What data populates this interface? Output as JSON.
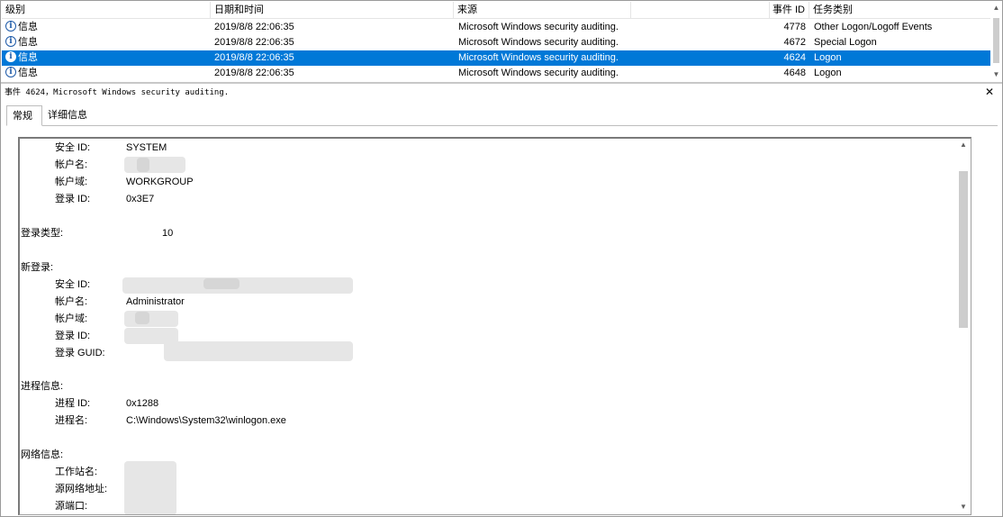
{
  "list": {
    "headers": {
      "level": "级别",
      "date": "日期和时间",
      "source": "来源",
      "event_id": "事件 ID",
      "task": "任务类别"
    },
    "rows": [
      {
        "level": "信息",
        "date": "2019/8/8 22:06:35",
        "source": "Microsoft Windows security auditing.",
        "event_id": "4778",
        "task": "Other Logon/Logoff Events"
      },
      {
        "level": "信息",
        "date": "2019/8/8 22:06:35",
        "source": "Microsoft Windows security auditing.",
        "event_id": "4672",
        "task": "Special Logon"
      },
      {
        "level": "信息",
        "date": "2019/8/8 22:06:35",
        "source": "Microsoft Windows security auditing.",
        "event_id": "4624",
        "task": "Logon"
      },
      {
        "level": "信息",
        "date": "2019/8/8 22:06:35",
        "source": "Microsoft Windows security auditing.",
        "event_id": "4648",
        "task": "Logon"
      }
    ],
    "selected_index": 2
  },
  "detail": {
    "title": "事件 4624，Microsoft Windows security auditing.",
    "close_glyph": "✕",
    "tabs": {
      "general": "常规",
      "details": "详细信息"
    }
  },
  "content": {
    "subject": {
      "security_id_label": "安全 ID:",
      "security_id": "SYSTEM",
      "account_name_label": "帐户名:",
      "account_domain_label": "帐户域:",
      "account_domain": "WORKGROUP",
      "logon_id_label": "登录 ID:",
      "logon_id": "0x3E7"
    },
    "logon_type_label": "登录类型:",
    "logon_type": "10",
    "new_logon": {
      "section": "新登录:",
      "security_id_label": "安全 ID:",
      "account_name_label": "帐户名:",
      "account_name": "Administrator",
      "account_domain_label": "帐户域:",
      "logon_id_label": "登录 ID:",
      "logon_guid_label": "登录 GUID:"
    },
    "process": {
      "section": "进程信息:",
      "process_id_label": "进程 ID:",
      "process_id": "0x1288",
      "process_name_label": "进程名:",
      "process_name": "C:\\Windows\\System32\\winlogon.exe"
    },
    "network": {
      "section": "网络信息:",
      "workstation_label": "工作站名:",
      "source_address_label": "源网络地址:",
      "source_port_label": "源端口:"
    }
  },
  "icons": {
    "info": "info-icon",
    "scroll_up": "▲",
    "scroll_down": "▼"
  }
}
